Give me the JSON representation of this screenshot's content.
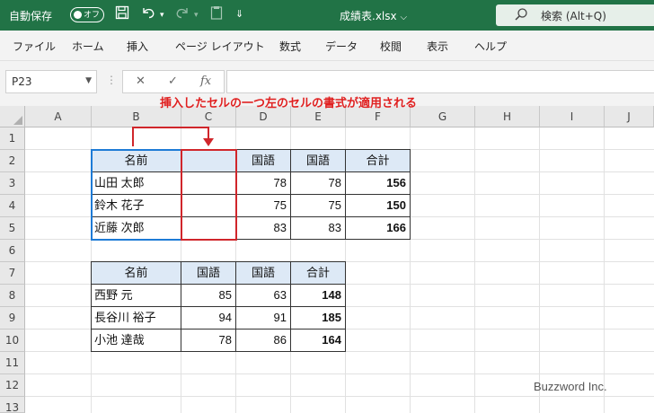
{
  "titlebar": {
    "autosave_label": "自動保存",
    "autosave_state": "オフ",
    "filename": "成績表.xlsx",
    "search_label": "検索 (Alt+Q)",
    "bg_color": "#217346"
  },
  "menu": [
    "ファイル",
    "ホーム",
    "挿入",
    "ページ レイアウト",
    "数式",
    "データ",
    "校閲",
    "表示",
    "ヘルプ"
  ],
  "formula_bar": {
    "name_box": "P23",
    "cancel_icon": "✕",
    "enter_icon": "✓",
    "fx_label": "fx",
    "formula": ""
  },
  "grid": {
    "columns": [
      "A",
      "B",
      "C",
      "D",
      "E",
      "F",
      "G",
      "H",
      "I",
      "J"
    ],
    "rows": [
      "1",
      "2",
      "3",
      "4",
      "5",
      "6",
      "7",
      "8",
      "9",
      "10",
      "11",
      "12",
      "13"
    ]
  },
  "table1": {
    "headers": [
      "名前",
      "",
      "国語",
      "国語",
      "合計"
    ],
    "rows": [
      [
        "山田 太郎",
        "",
        "78",
        "78",
        "156"
      ],
      [
        "鈴木 花子",
        "",
        "75",
        "75",
        "150"
      ],
      [
        "近藤 次郎",
        "",
        "83",
        "83",
        "166"
      ]
    ]
  },
  "table2": {
    "headers": [
      "名前",
      "国語",
      "国語",
      "合計"
    ],
    "rows": [
      [
        "西野 元",
        "85",
        "63",
        "148"
      ],
      [
        "長谷川 裕子",
        "94",
        "91",
        "185"
      ],
      [
        "小池 達哉",
        "78",
        "86",
        "164"
      ]
    ]
  },
  "annotation": "挿入したセルの一つ左のセルの書式が適用される",
  "watermark": "Buzzword Inc.",
  "colors": {
    "header_fill": "#dde9f6",
    "selection_blue": "#1e7bd6",
    "highlight_red": "#d0262b",
    "annotation_red": "#e02020"
  }
}
